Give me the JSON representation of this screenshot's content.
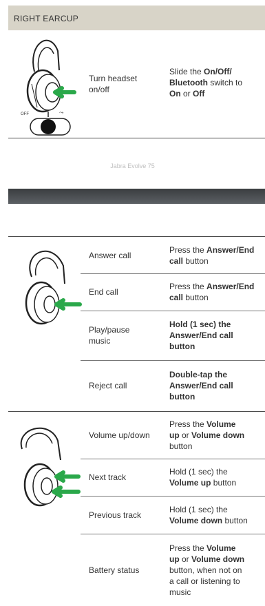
{
  "section_title": "RIGHT EARCUP",
  "power": {
    "action": "Turn headset on/off",
    "instruction": [
      "Slide the ",
      {
        "b": "On/Off/"
      },
      "|",
      {
        "b": "Bluetooth"
      },
      " switch to",
      "|",
      {
        "b": "On"
      },
      " or ",
      {
        "b": "Off"
      }
    ],
    "switch_labels": {
      "off": "OFF",
      "on": "⤳"
    }
  },
  "footer_text": "Jabra Evolve 75",
  "call_rows": [
    {
      "action": "Answer call",
      "instruction": [
        "Press the ",
        {
          "b": "Answer/End"
        },
        "|",
        {
          "b": "call"
        },
        " button"
      ]
    },
    {
      "action": "End call",
      "instruction": [
        "Press the ",
        {
          "b": "Answer/End"
        },
        "|",
        {
          "b": "call"
        },
        " button"
      ]
    },
    {
      "action": "Play/pause music",
      "instruction": [
        {
          "b": "Hold (1 sec) the"
        },
        "|",
        {
          "b": "Answer/End call"
        },
        "|",
        {
          "b": "button"
        }
      ]
    },
    {
      "action": "Reject call",
      "instruction": [
        {
          "b": "Double-tap the"
        },
        "|",
        {
          "b": "Answer/End call"
        },
        "|",
        {
          "b": "button"
        }
      ]
    }
  ],
  "volume_rows": [
    {
      "action": "Volume up/down",
      "instruction": [
        "Press the ",
        {
          "b": "Volume"
        },
        "|",
        {
          "b": "up"
        },
        " or ",
        {
          "b": "Volume down"
        },
        "|",
        "button"
      ]
    },
    {
      "action": "Next track",
      "instruction": [
        "Hold (1 sec) the",
        "|",
        {
          "b": "Volume up"
        },
        " button"
      ]
    },
    {
      "action": "Previous track",
      "instruction": [
        "Hold (1 sec) the",
        "|",
        {
          "b": "Volume down"
        },
        " button"
      ]
    },
    {
      "action": "Battery status",
      "instruction": [
        "Press the ",
        {
          "b": "Volume"
        },
        "|",
        {
          "b": "up"
        },
        " or ",
        {
          "b": "Volume down"
        },
        "|",
        "button, when not on",
        "|",
        "a call or listening to",
        "|",
        "music"
      ]
    }
  ],
  "colors": {
    "arrow": "#2aa84a",
    "header_bg": "#d8d4c8",
    "bar_dark": "#3a3d40"
  }
}
